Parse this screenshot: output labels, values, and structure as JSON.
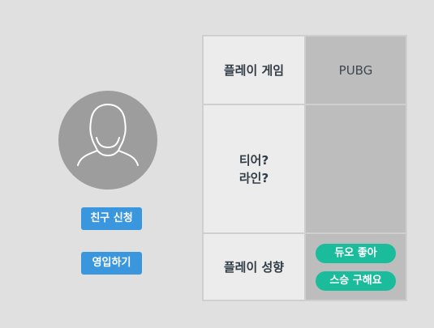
{
  "profile": {
    "avatar_icon": "user-silhouette-icon",
    "buttons": {
      "friend_request": "친구 신청",
      "recruit": "영입하기"
    }
  },
  "info_table": {
    "game": {
      "label": "플레이 게임",
      "value": "PUBG"
    },
    "tier": {
      "label_line1": "티어?",
      "label_line2": "라인?",
      "value": ""
    },
    "play_style": {
      "label": "플레이 성향",
      "tags": [
        "듀오 좋아",
        "스승 구해요"
      ]
    }
  },
  "colors": {
    "background": "#e0e0e0",
    "button_blue": "#3a97dd",
    "tag_green": "#1abc9c",
    "label_cell": "#ececec",
    "value_cell": "#bdbdbd"
  }
}
